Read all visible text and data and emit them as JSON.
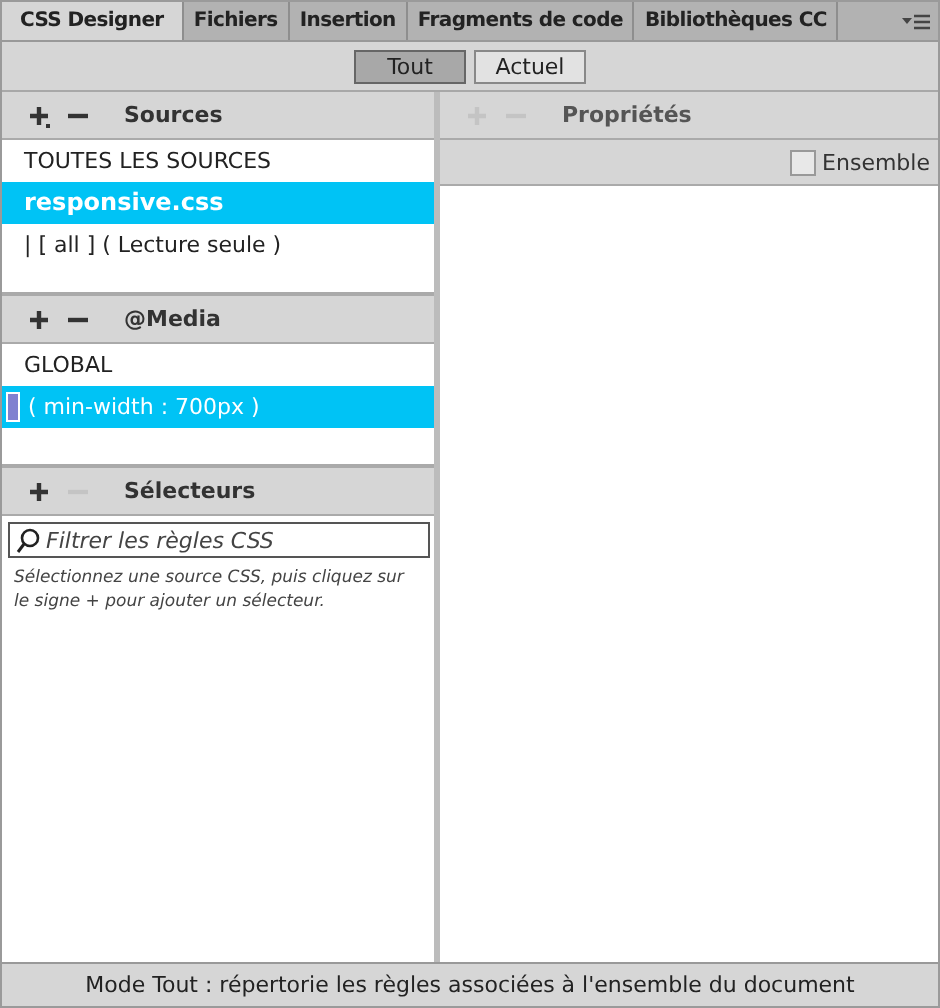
{
  "tabs": [
    {
      "label": "CSS Designer",
      "selected": true
    },
    {
      "label": "Fichiers",
      "selected": false
    },
    {
      "label": "Insertion",
      "selected": false
    },
    {
      "label": "Fragments de code",
      "selected": false
    },
    {
      "label": "Bibliothèques CC",
      "selected": false
    }
  ],
  "mode_buttons": [
    {
      "label": "Tout",
      "selected": true
    },
    {
      "label": "Actuel",
      "selected": false
    }
  ],
  "sources": {
    "title": "Sources",
    "add_disabled": false,
    "remove_disabled": false,
    "items": [
      {
        "label": "TOUTES LES SOURCES",
        "selected": false
      },
      {
        "label": "responsive.css",
        "selected": true
      },
      {
        "label": "| [ all ] ( Lecture seule )",
        "selected": false
      }
    ]
  },
  "media": {
    "title": "@Media",
    "add_disabled": false,
    "remove_disabled": false,
    "items": [
      {
        "label": "GLOBAL",
        "selected": false
      },
      {
        "label": "( min-width : 700px )",
        "selected": true
      }
    ]
  },
  "selectors": {
    "title": "Sélecteurs",
    "add_disabled": false,
    "remove_disabled": true,
    "placeholder": "Filtrer les règles CSS",
    "hint": "Sélectionnez une source CSS, puis cliquez sur le signe + pour ajouter un sélecteur."
  },
  "properties": {
    "title": "Propriétés",
    "add_disabled": true,
    "remove_disabled": true,
    "ensemble_label": "Ensemble",
    "ensemble_checked": false
  },
  "status_bar": "Mode Tout : répertorie les règles associées à l'ensemble du document"
}
